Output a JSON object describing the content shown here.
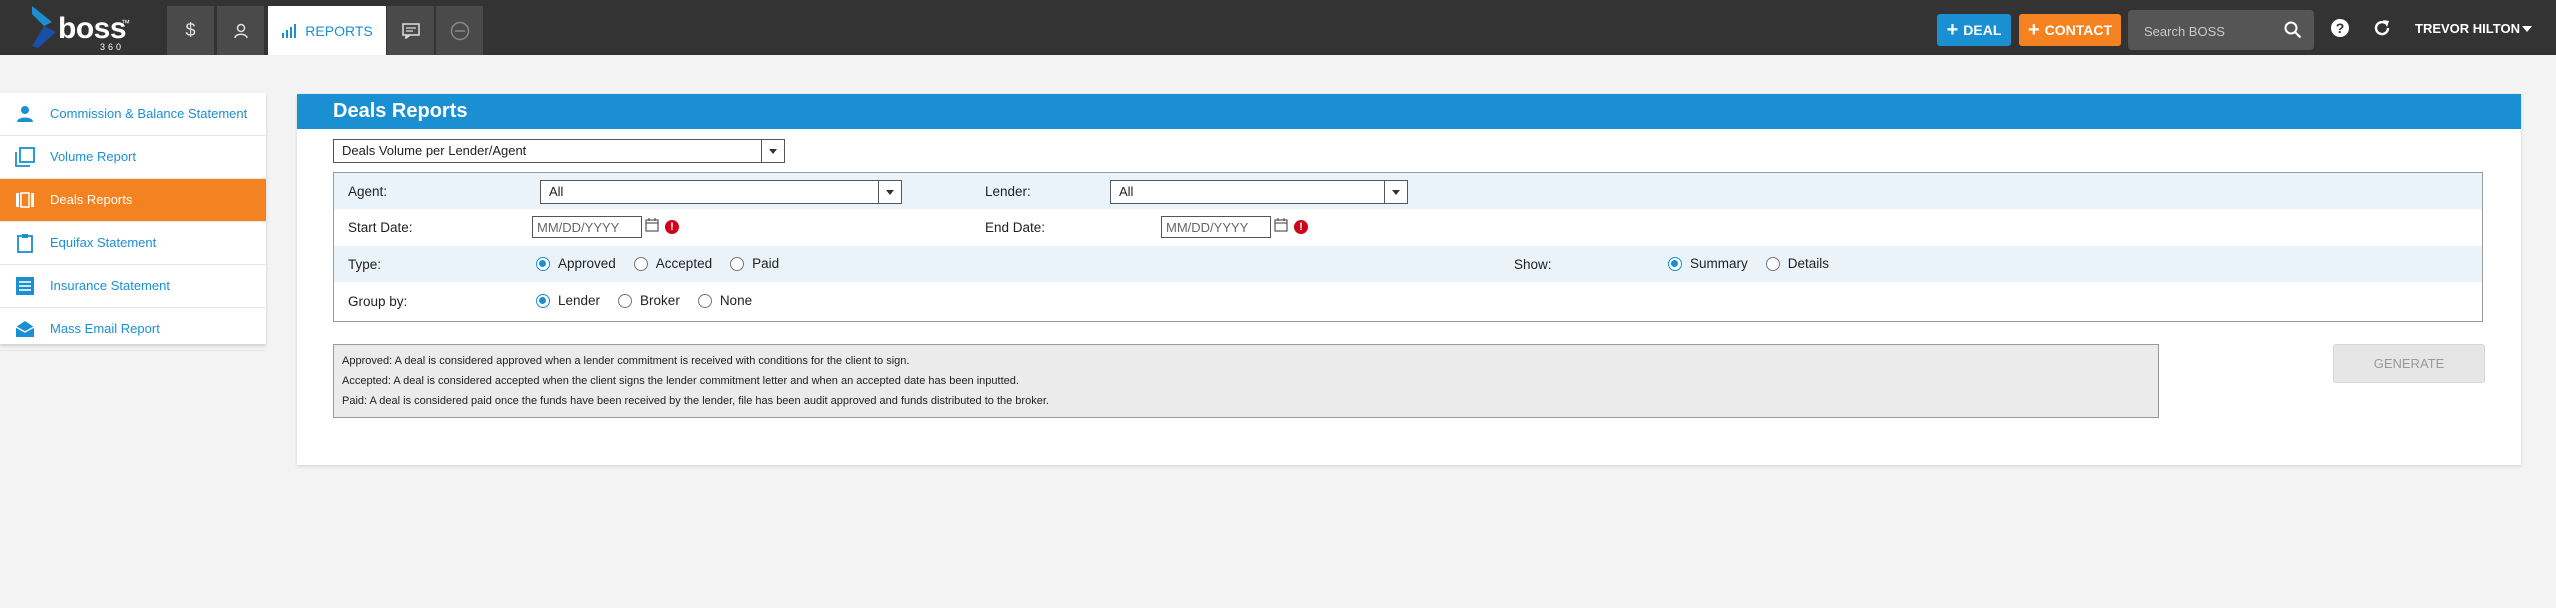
{
  "header": {
    "logo_text": "boss",
    "logo_sub": "360",
    "nav_tabs": [
      {
        "icon": "dollar-icon",
        "label": ""
      },
      {
        "icon": "person-icon",
        "label": ""
      },
      {
        "icon": "bar-chart-icon",
        "label": "REPORTS"
      },
      {
        "icon": "chat-icon",
        "label": ""
      },
      {
        "icon": "more-circle-icon",
        "label": ""
      }
    ],
    "deal_button": "DEAL",
    "contact_button": "CONTACT",
    "search_placeholder": "Search BOSS",
    "user_name": "TREVOR HILTON",
    "colors": {
      "bar": "#333333",
      "blue": "#1a8fd1",
      "orange": "#f58220"
    }
  },
  "sidebar": {
    "items": [
      {
        "label": "Commission & Balance Statement",
        "icon": "person-icon",
        "active": false
      },
      {
        "label": "Volume Report",
        "icon": "copy-icon",
        "active": false
      },
      {
        "label": "Deals Reports",
        "icon": "columns-icon",
        "active": true
      },
      {
        "label": "Equifax Statement",
        "icon": "clipboard-icon",
        "active": false
      },
      {
        "label": "Insurance Statement",
        "icon": "list-icon",
        "active": false
      },
      {
        "label": "Mass Email Report",
        "icon": "envelope-open-icon",
        "active": false
      }
    ]
  },
  "main": {
    "title": "Deals Reports",
    "report_type": "Deals Volume per Lender/Agent",
    "filters": {
      "agent_label": "Agent:",
      "agent_value": "All",
      "lender_label": "Lender:",
      "lender_value": "All",
      "start_label": "Start Date:",
      "end_label": "End Date:",
      "date_placeholder": "MM/DD/YYYY",
      "error_glyph": "!",
      "type_label": "Type:",
      "type_options": [
        "Approved",
        "Accepted",
        "Paid"
      ],
      "type_selected": "Approved",
      "show_label": "Show:",
      "show_options": [
        "Summary",
        "Details"
      ],
      "show_selected": "Summary",
      "group_label": "Group by:",
      "group_options": [
        "Lender",
        "Broker",
        "None"
      ],
      "group_selected": "Lender"
    },
    "notes": [
      "Approved: A deal is considered approved when a lender commitment is received with conditions for the client to sign.",
      "Accepted: A deal is considered accepted when the client signs the lender commitment letter and when an accepted date has been inputted.",
      "Paid: A deal is considered paid once the funds have been received by the lender, file has been audit approved and funds distributed to the broker."
    ],
    "generate_button": "GENERATE"
  }
}
